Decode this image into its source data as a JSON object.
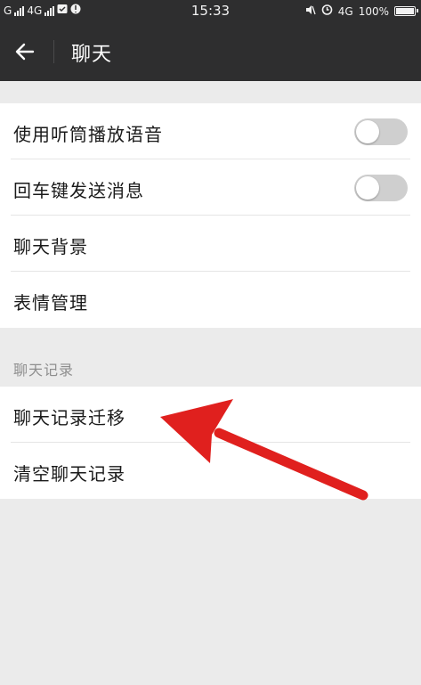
{
  "status_bar": {
    "carrier1": "G",
    "carrier2": "4G",
    "time": "15:33",
    "network": "4G",
    "battery": "100%"
  },
  "header": {
    "title": "聊天",
    "back_icon": "arrow-left-icon"
  },
  "settings": {
    "items": [
      {
        "label": "使用听筒播放语音",
        "toggle": false
      },
      {
        "label": "回车键发送消息",
        "toggle": false
      },
      {
        "label": "聊天背景"
      },
      {
        "label": "表情管理"
      }
    ]
  },
  "history_section": {
    "header": "聊天记录",
    "items": [
      {
        "label": "聊天记录迁移"
      },
      {
        "label": "清空聊天记录"
      }
    ]
  },
  "colors": {
    "topbar": "#2e2e2f",
    "page_bg": "#ebebeb",
    "toggle_off": "#cfcfcf",
    "annotation_arrow": "#e0201e"
  }
}
